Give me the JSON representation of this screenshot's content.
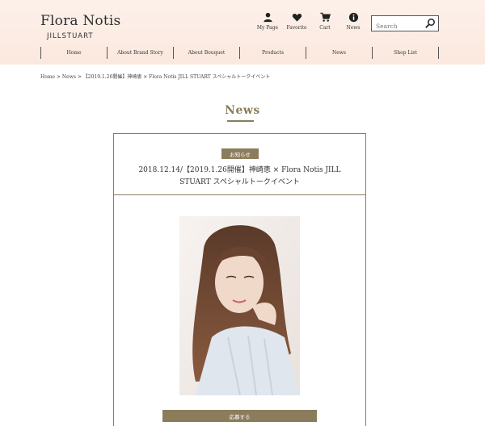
{
  "brand": {
    "name": "Flora Notis",
    "sub": "JILLSTUART"
  },
  "utility": [
    {
      "label": "My Page",
      "icon": "person-icon"
    },
    {
      "label": "Favorite",
      "icon": "heart-icon"
    },
    {
      "label": "Cart",
      "icon": "cart-icon"
    },
    {
      "label": "News",
      "icon": "info-icon"
    }
  ],
  "search": {
    "placeholder": "Search",
    "icon": "search-icon"
  },
  "nav": [
    "Home",
    "About Brand Story",
    "About Bouquet",
    "Products",
    "News",
    "Shop List"
  ],
  "breadcrumb": "Home > News > 【2019.1.26開催】神崎恵 × Flora Notis JILL STUART スペシャルトークイベント",
  "page_title": "News",
  "article": {
    "badge": "お知らせ",
    "title_line1": "2018.12.14/【2019.1.26開催】神崎恵 × Flora Notis JILL",
    "title_line2": "STUART スペシャルトークイベント",
    "apply_label": "応募する"
  },
  "colors": {
    "accent": "#8b7d5c",
    "header_bg": "#fbe8de"
  }
}
